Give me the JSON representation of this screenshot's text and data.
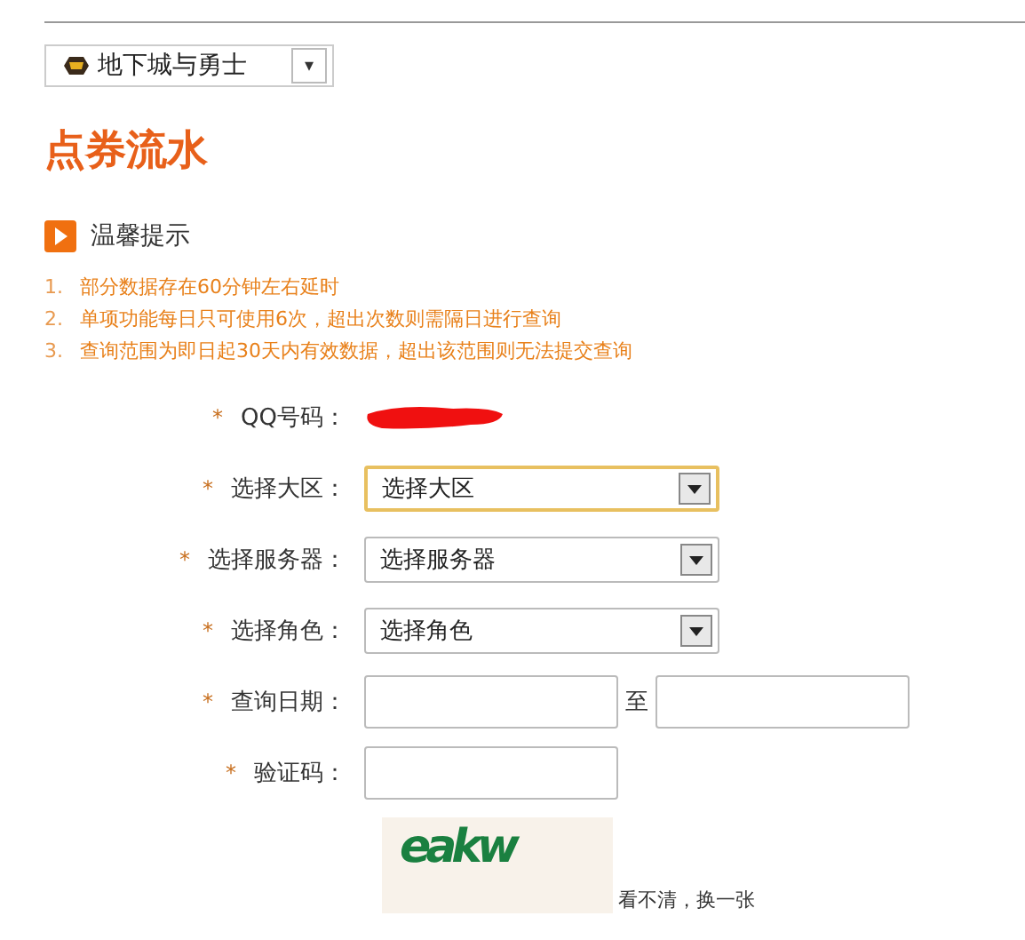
{
  "game_select": {
    "value": "地下城与勇士",
    "caret": "▾"
  },
  "title": "点券流水",
  "tips": {
    "heading": "温馨提示",
    "items": [
      {
        "number": "1.",
        "text": "部分数据存在60分钟左右延时"
      },
      {
        "number": "2.",
        "text": "单项功能每日只可使用6次，超出次数则需隔日进行查询"
      },
      {
        "number": "3.",
        "text": "查询范围为即日起30天内有效数据，超出该范围则无法提交查询"
      }
    ]
  },
  "form": {
    "rows": [
      {
        "kind": "redacted",
        "required_mark": "*",
        "label": "QQ号码："
      },
      {
        "kind": "select",
        "required_mark": "*",
        "label": "选择大区：",
        "value": "选择大区",
        "focused": true
      },
      {
        "kind": "select",
        "required_mark": "*",
        "label": "选择服务器：",
        "value": "选择服务器",
        "focused": false
      },
      {
        "kind": "select",
        "required_mark": "*",
        "label": "选择角色：",
        "value": "选择角色",
        "focused": false
      },
      {
        "kind": "daterange",
        "required_mark": "*",
        "label": "查询日期：",
        "separator": "至"
      },
      {
        "kind": "text",
        "required_mark": "*",
        "label": "验证码："
      }
    ]
  },
  "captcha": {
    "text": "eakw",
    "refresh_link": "看不清，换一张"
  }
}
